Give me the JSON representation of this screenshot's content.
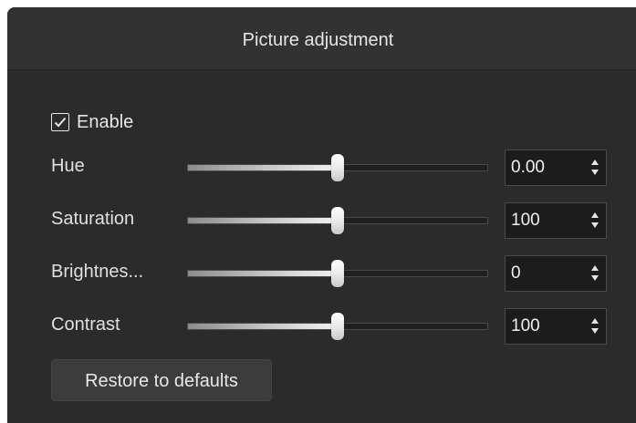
{
  "window": {
    "title": "Picture adjustment"
  },
  "enable": {
    "label": "Enable",
    "checked": true
  },
  "adjustments": [
    {
      "label": "Hue",
      "value": "0.00",
      "slider_fraction": 0.5
    },
    {
      "label": "Saturation",
      "value": "100",
      "slider_fraction": 0.5
    },
    {
      "label": "Brightnes...",
      "value": "0",
      "slider_fraction": 0.5
    },
    {
      "label": "Contrast",
      "value": "100",
      "slider_fraction": 0.5
    }
  ],
  "restore_button": {
    "label": "Restore to defaults"
  },
  "icons": {
    "checkbox": "checkmark-icon",
    "spin_up": "chevron-up-icon",
    "spin_down": "chevron-down-icon"
  },
  "colors": {
    "panel_background": "#2b2b2b",
    "title_bar": "#323232",
    "text": "#e6e6e6",
    "input_background": "#1c1c1c"
  }
}
